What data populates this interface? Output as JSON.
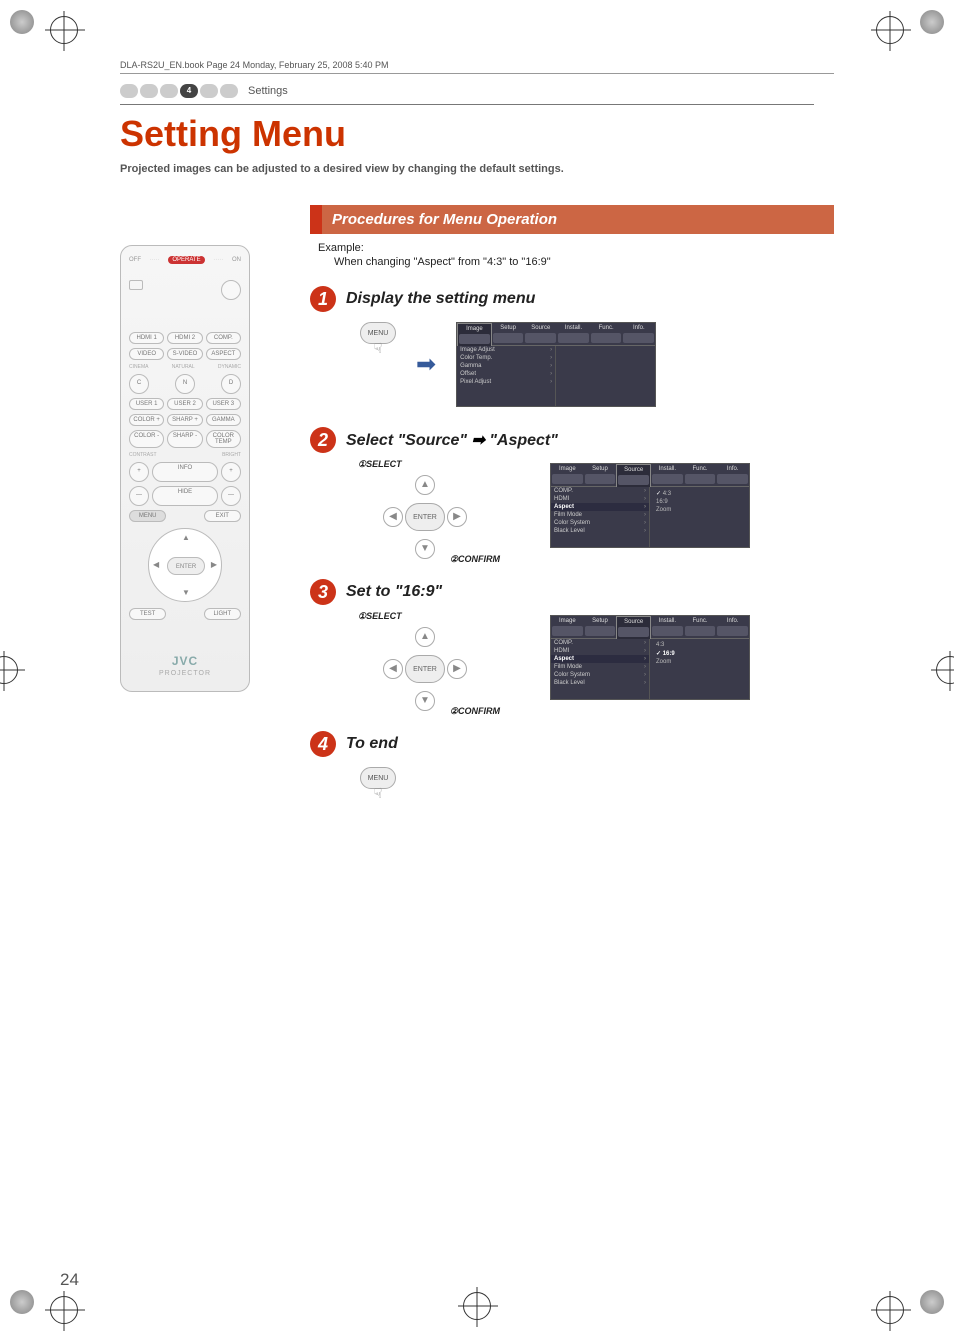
{
  "book_header": "DLA-RS2U_EN.book  Page 24  Monday, February 25, 2008  5:40 PM",
  "section_tab": {
    "number": "4",
    "label": "Settings"
  },
  "page_number": "24",
  "title": "Setting Menu",
  "intro": "Projected images can be adjusted to a desired view by changing the default settings.",
  "procedures_heading": "Procedures for Menu Operation",
  "example_label": "Example:",
  "example_text": "When changing \"Aspect\" from \"4:3\" to \"16:9\"",
  "steps": {
    "s1": {
      "num": "1",
      "title": "Display the setting menu"
    },
    "s2": {
      "num": "2",
      "title_a": "Select \"Source\"",
      "title_b": "\"Aspect\""
    },
    "s3": {
      "num": "3",
      "title": "Set to \"16:9\""
    },
    "s4": {
      "num": "4",
      "title": "To end"
    }
  },
  "annot": {
    "select": "SELECT",
    "confirm": "CONFIRM",
    "select_num": "①",
    "confirm_num": "②"
  },
  "dpad": {
    "enter": "ENTER",
    "up": "▲",
    "down": "▼",
    "left": "◀",
    "right": "▶"
  },
  "menu_btn": "MENU",
  "osd": {
    "tabs": [
      "Image",
      "Setup",
      "Source",
      "Install.",
      "Func.",
      "Info."
    ],
    "image_items": [
      "Image Adjust",
      "Color Temp.",
      "Gamma",
      "Offset",
      "Pixel Adjust"
    ],
    "source_items": [
      "COMP.",
      "HDMI",
      "Aspect",
      "Film Mode",
      "Color System",
      "Black Level"
    ],
    "aspect_values_step2": {
      "list": [
        "4:3",
        "16:9",
        "Zoom"
      ],
      "checked": "4:3"
    },
    "aspect_values_step3": {
      "list": [
        "4:3",
        "16:9",
        "Zoom"
      ],
      "checked": "16:9"
    }
  },
  "remote": {
    "operate": "OPERATE",
    "off": "OFF",
    "on": "ON",
    "row_input": [
      "HDMI 1",
      "HDMI 2",
      "COMP."
    ],
    "row_vid": [
      "VIDEO",
      "S-VIDEO",
      "ASPECT"
    ],
    "row_cnv_lbl": [
      "CINEMA",
      "NATURAL",
      "DYNAMIC"
    ],
    "row_cnv": [
      "C",
      "N",
      "D"
    ],
    "row_user": [
      "USER 1",
      "USER 2",
      "USER 3"
    ],
    "row_cs1": [
      "COLOR +",
      "SHARP +",
      "GAMMA"
    ],
    "row_cs2": [
      "COLOR -",
      "SHARP -",
      "COLOR TEMP"
    ],
    "contrast": "CONTRAST",
    "bright": "BRIGHT",
    "plus": "+",
    "minus": "—",
    "info": "INFO",
    "hide": "HIDE",
    "menu": "MENU",
    "exit": "EXIT",
    "enter": "ENTER",
    "test": "TEST",
    "light": "LIGHT",
    "brand": "JVC",
    "projector": "PROJECTOR"
  }
}
